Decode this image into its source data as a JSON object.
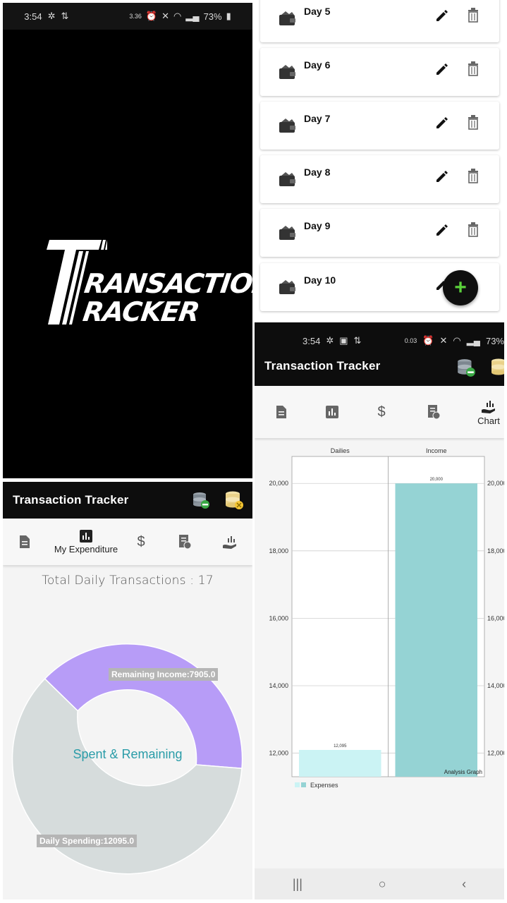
{
  "splash": {
    "status": {
      "time": "3:54",
      "speed": "3.36",
      "speed_unit": "K/s",
      "battery": "73%"
    },
    "logo": {
      "line1": "RANSACTION",
      "line2": "RACKER"
    }
  },
  "list": {
    "days": [
      {
        "label": "Day 5"
      },
      {
        "label": "Day 6"
      },
      {
        "label": "Day 7"
      },
      {
        "label": "Day 8"
      },
      {
        "label": "Day 9"
      },
      {
        "label": "Day 10"
      }
    ],
    "fab_label": "+"
  },
  "donut_screen": {
    "app_title": "Transaction Tracker",
    "tabs": [
      {
        "icon": "document-icon",
        "label": ""
      },
      {
        "icon": "bar-chart-icon",
        "label": "My Expenditure"
      },
      {
        "icon": "dollar-icon",
        "label": ""
      },
      {
        "icon": "invoice-icon",
        "label": ""
      },
      {
        "icon": "hand-chart-icon",
        "label": ""
      }
    ],
    "total_text": "Total Daily Transactions : 17",
    "center_text": "Spent & Remaining",
    "remaining_label": "Remaining Income:7905.0",
    "spending_label": "Daily Spending:12095.0",
    "colors": {
      "remaining": "#b79cf7",
      "spending": "#d6dcdc"
    }
  },
  "bar_screen": {
    "status": {
      "time": "3:54",
      "speed": "0.03",
      "speed_unit": "K/s",
      "battery": "73%"
    },
    "app_title": "Transaction Tracker",
    "tabs": [
      {
        "icon": "document-icon",
        "label": ""
      },
      {
        "icon": "bar-chart-icon",
        "label": ""
      },
      {
        "icon": "dollar-icon",
        "label": ""
      },
      {
        "icon": "invoice-icon",
        "label": ""
      },
      {
        "icon": "hand-chart-icon",
        "label": "Chart"
      }
    ],
    "nav": {
      "recent": "|||",
      "home": "○",
      "back": "‹"
    }
  },
  "chart_data": {
    "type": "bar",
    "categories": [
      "Dailies",
      "Income"
    ],
    "values": [
      12095,
      20000
    ],
    "value_labels": [
      "12,095",
      "20,000"
    ],
    "yticks": [
      "12,000",
      "14,000",
      "16,000",
      "18,000",
      "20,000"
    ],
    "ylim": [
      11300,
      20800
    ],
    "legend": "Expenses",
    "description": "Analysis Graph",
    "colors": [
      "#cbf3f4",
      "#95d3d4"
    ]
  }
}
